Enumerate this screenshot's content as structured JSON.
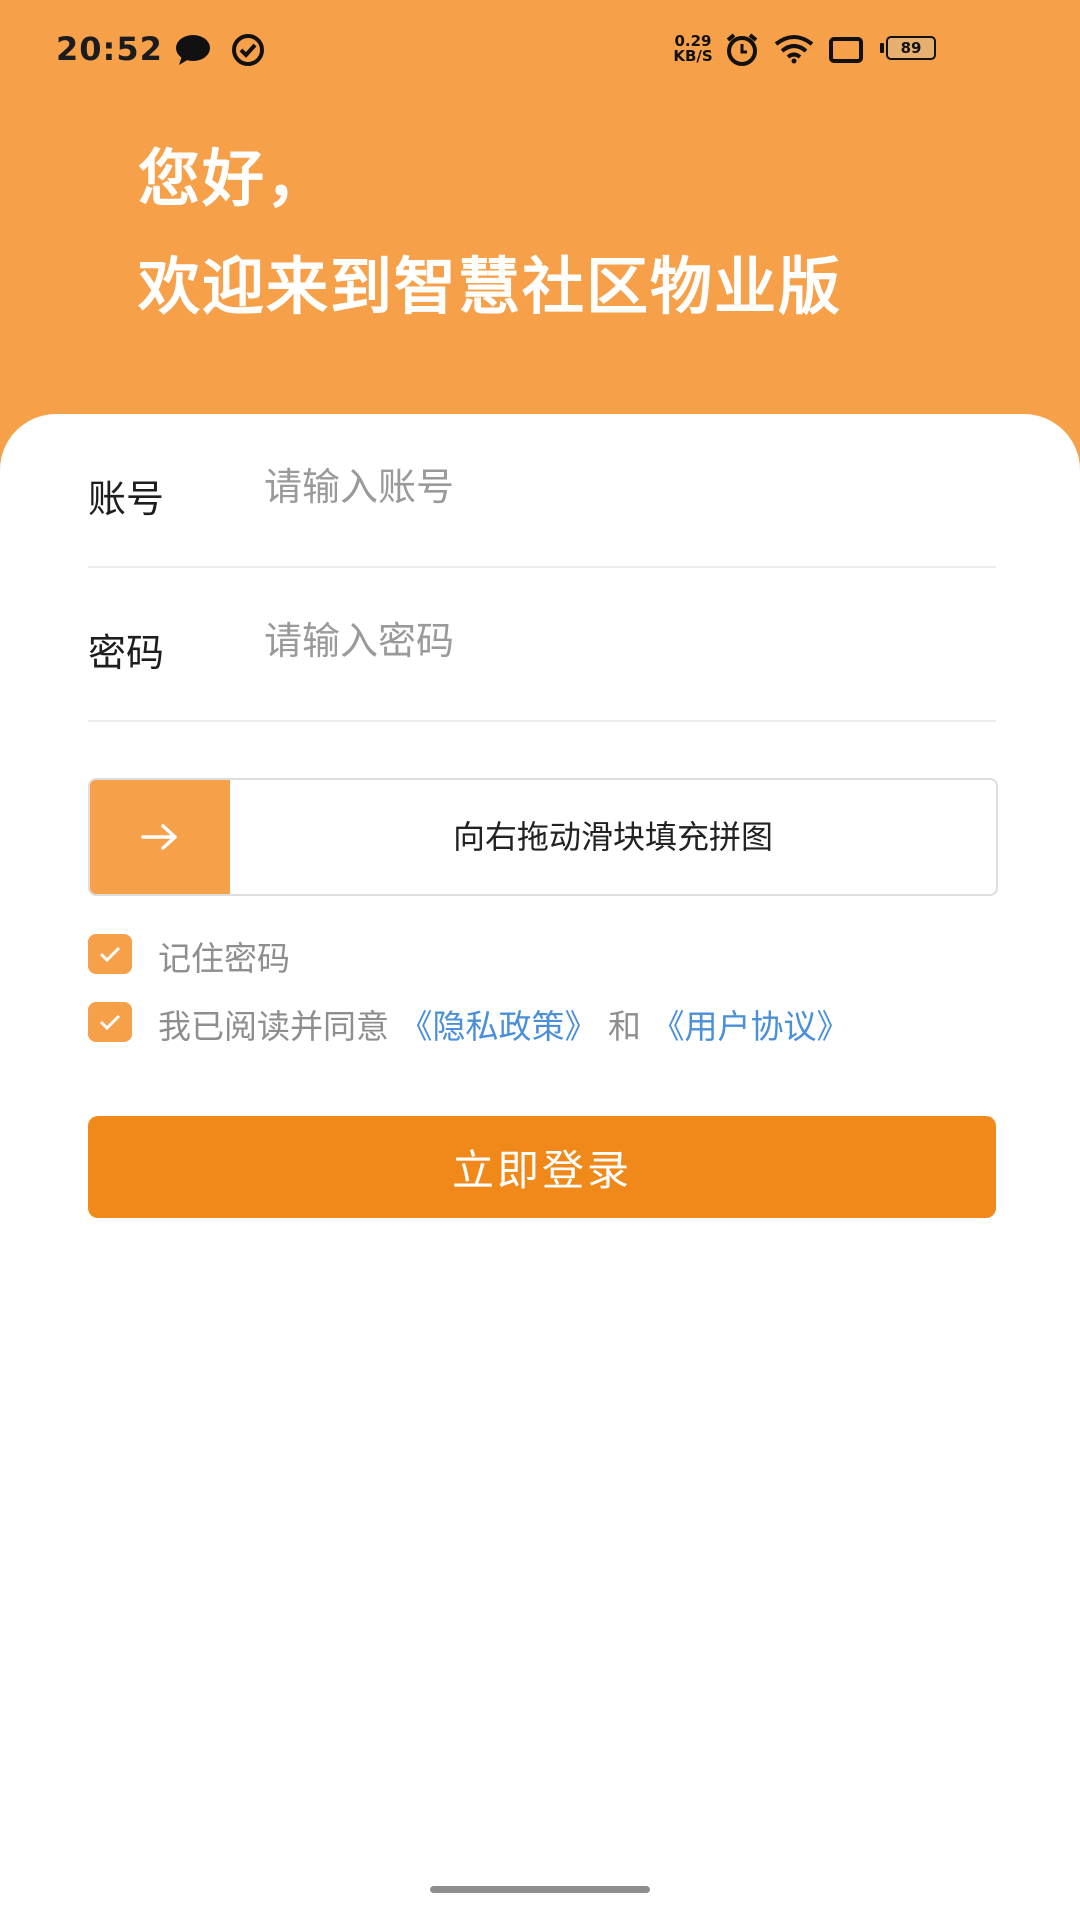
{
  "status_bar": {
    "time": "20:52",
    "net_speed_value": "0.29",
    "net_speed_unit": "KB/S",
    "battery": "89",
    "icons": [
      "chat-icon",
      "check-circle-icon",
      "alarm-icon",
      "wifi-icon",
      "screen-icon",
      "battery-icon"
    ]
  },
  "header": {
    "greeting": "您好，",
    "welcome": "欢迎来到智慧社区物业版"
  },
  "form": {
    "account_label": "账号",
    "account_placeholder": "请输入账号",
    "password_label": "密码",
    "password_placeholder": "请输入密码"
  },
  "slider": {
    "hint": "向右拖动滑块填充拼图",
    "progress": 0
  },
  "options": {
    "remember": {
      "label": "记住密码",
      "checked": true
    },
    "agreement": {
      "checked": true,
      "prefix": "我已阅读并同意",
      "privacy_link": "《隐私政策》",
      "conjunction": "和",
      "terms_link": "《用户协议》"
    }
  },
  "login_button": "立即登录",
  "colors": {
    "header_bg": "#f6a04a",
    "button_bg": "#f0891a",
    "link": "#4a8fd8"
  }
}
